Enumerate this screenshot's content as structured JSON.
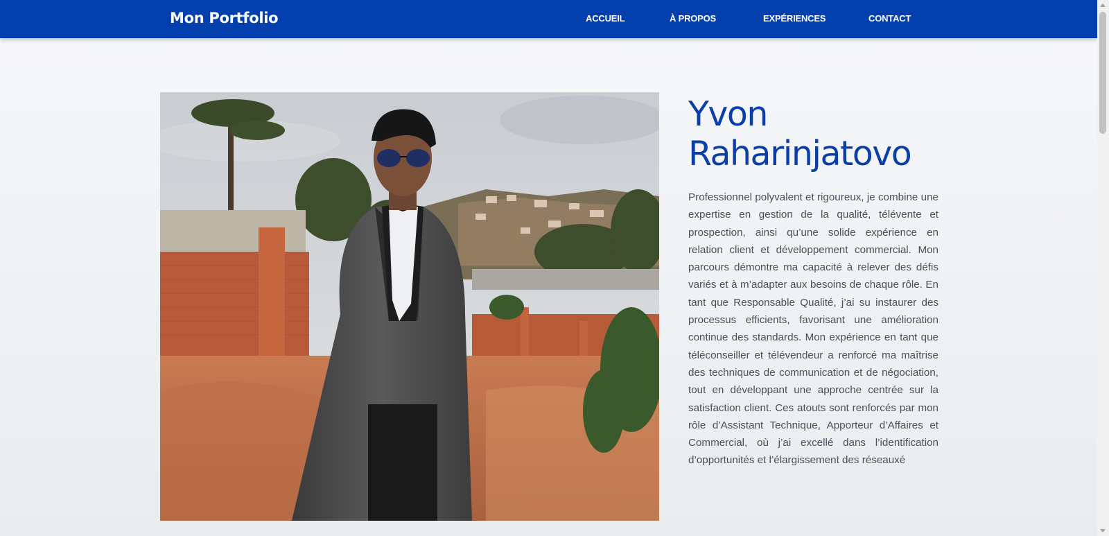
{
  "header": {
    "brand": "Mon Portfolio",
    "nav": [
      {
        "label": "ACCUEIL"
      },
      {
        "label": "À PROPOS"
      },
      {
        "label": "EXPÉRIENCES"
      },
      {
        "label": "CONTACT"
      }
    ]
  },
  "profile": {
    "first_name": "Yvon",
    "last_name": "Raharinjatovo",
    "bio": "Professionnel polyvalent et rigoureux, je combine une expertise en gestion de la qualité, télévente et prospection, ainsi qu’une solide expérience en relation client et développement commercial. Mon parcours démontre ma capacité à relever des défis variés et à m’adapter aux besoins de chaque rôle. En tant que Responsable Qualité, j’ai su instaurer des processus efficients, favorisant une amélioration continue des standards. Mon expérience en tant que téléconseiller et télévendeur a renforcé ma maîtrise des techniques de communication et de négociation, tout en développant une approche centrée sur la satisfaction client. Ces atouts sont renforcés par mon rôle d’Assistant Technique, Apporteur d’Affaires et Commercial, où j’ai excellé dans l’identification d’opportunités et l’élargissement des réseauxé"
  },
  "colors": {
    "primary": "#0340ad",
    "name_text": "#0a3fa8",
    "body_text": "#4a4f59"
  }
}
